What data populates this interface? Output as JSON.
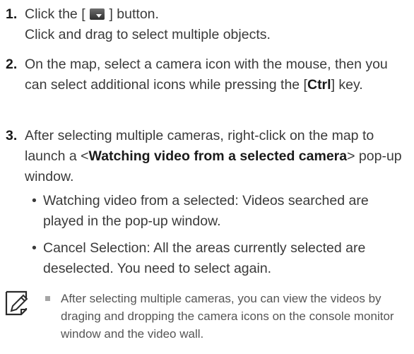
{
  "steps": [
    {
      "num": "1.",
      "line1_pre": "Click the [",
      "line1_post": "] button.",
      "line2": "Click and drag to select multiple objects."
    },
    {
      "num": "2.",
      "text_pre": "On the map, select a camera icon with the mouse, then you can select additional icons while pressing the [",
      "key": "Ctrl",
      "text_post": "] key."
    },
    {
      "num": "3.",
      "text_pre": "After selecting multiple cameras, right-click on the map to launch a <",
      "bold": "Watching video from a selected camera",
      "text_post": "> pop-up window.",
      "bullets": [
        "Watching video from a selected: Videos searched are played in the pop-up window.",
        "Cancel Selection: All the areas currently selected are deselected. You need to select again."
      ]
    }
  ],
  "note": {
    "icon": "note-pencil-icon",
    "text": "After selecting multiple cameras, you can view the videos by draging and dropping the camera icons on the console monitor window and the video wall."
  }
}
